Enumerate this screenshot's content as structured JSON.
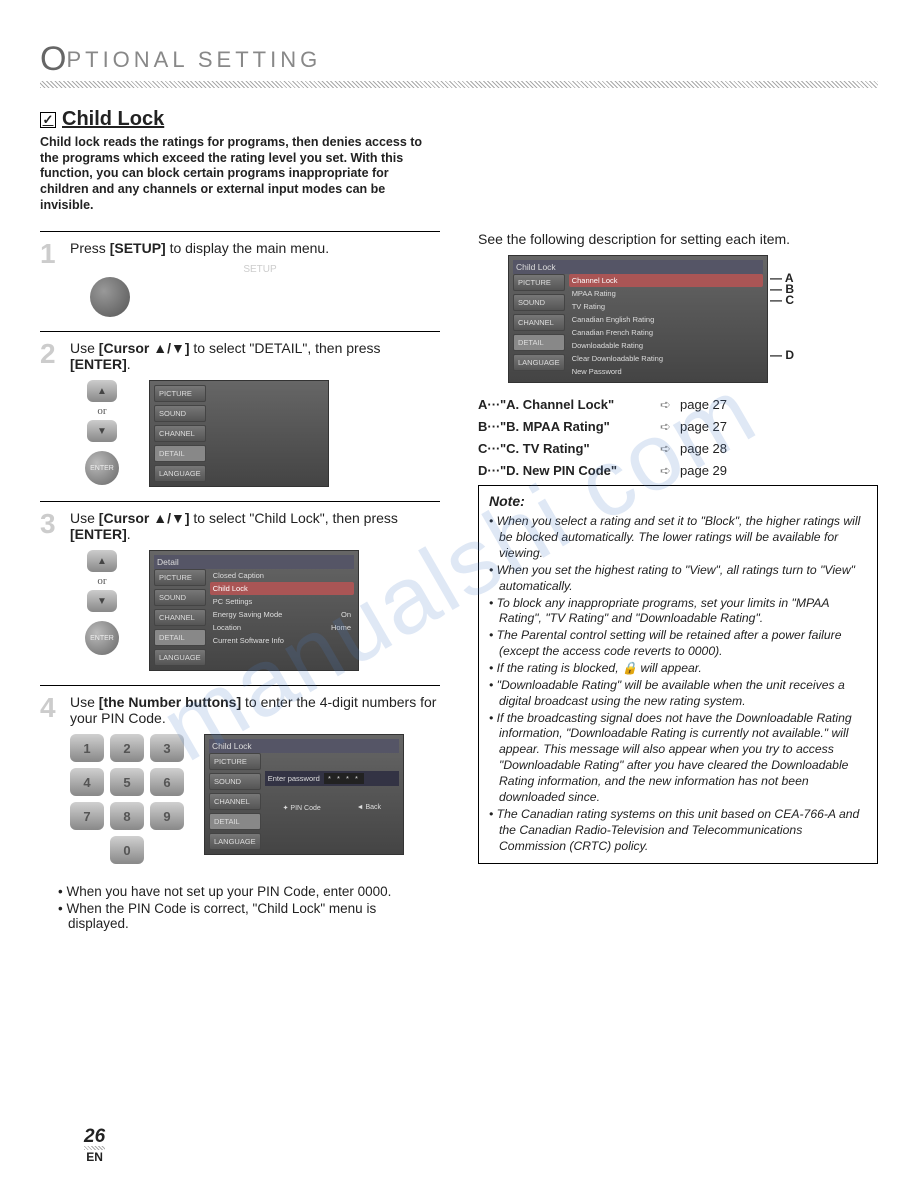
{
  "header": {
    "category": "PTIONAL   SETTING"
  },
  "section": {
    "title": "Child Lock",
    "intro": "Child lock reads the ratings for programs, then denies access to the programs which exceed the rating level you set. With this function, you can block certain programs inappropriate for children and any channels or external input modes can be invisible."
  },
  "steps": {
    "s1": {
      "num": "1",
      "text_a": "Press ",
      "btn": "[SETUP]",
      "text_b": " to display the main menu.",
      "label": "SETUP"
    },
    "s2": {
      "num": "2",
      "text_a": "Use ",
      "btn": "[Cursor ▲/▼]",
      "text_b": " to select \"DETAIL\", then press ",
      "btn2": "[ENTER]",
      "text_c": ".",
      "or": "or",
      "enter": "ENTER"
    },
    "s3": {
      "num": "3",
      "text_a": "Use ",
      "btn": "[Cursor ▲/▼]",
      "text_b": " to select \"Child Lock\", then press ",
      "btn2": "[ENTER]",
      "text_c": ".",
      "or": "or",
      "enter": "ENTER"
    },
    "s4": {
      "num": "4",
      "text_a": "Use ",
      "btn": "[the Number buttons]",
      "text_b": " to enter the 4-digit numbers for your PIN Code."
    },
    "bullets": [
      "When you have not set up your PIN Code, enter 0000.",
      "When the PIN Code is correct, \"Child Lock\" menu is displayed."
    ]
  },
  "keypad": [
    "1",
    "2",
    "3",
    "4",
    "5",
    "6",
    "7",
    "8",
    "9",
    "0"
  ],
  "osd_tabs": [
    "PICTURE",
    "SOUND",
    "CHANNEL",
    "DETAIL",
    "LANGUAGE"
  ],
  "osd2_items": [
    "",
    "",
    "",
    "",
    ""
  ],
  "osd3": {
    "title": "Detail",
    "items": [
      "Closed Caption",
      "Child Lock",
      "PC Settings",
      "Energy Saving Mode",
      "Location",
      "Current Software Info"
    ],
    "vals": [
      "",
      "",
      "",
      "On",
      "Home",
      ""
    ]
  },
  "osd4": {
    "title": "Child Lock",
    "enter_pw": "Enter password",
    "footer_l": "PIN Code",
    "footer_r": "Back"
  },
  "right": {
    "intro": "See the following description for setting each item.",
    "osd_title": "Child Lock",
    "osd_items": [
      "Channel Lock",
      "MPAA Rating",
      "TV Rating",
      "Canadian English Rating",
      "Canadian French Rating",
      "Downloadable Rating",
      "Clear Downloadable Rating",
      "New Password"
    ],
    "callouts": {
      "A": "A",
      "B": "B",
      "C": "C",
      "D": "D"
    },
    "legend": [
      {
        "k": "A",
        "t": "\"A. Channel Lock\"",
        "p": "page 27"
      },
      {
        "k": "B",
        "t": "\"B. MPAA Rating\"",
        "p": "page 27"
      },
      {
        "k": "C",
        "t": "\"C. TV Rating\"",
        "p": "page 28"
      },
      {
        "k": "D",
        "t": "\"D. New PIN Code\"",
        "p": "page 29"
      }
    ],
    "note_title": "Note:",
    "notes": [
      "When you select a rating and set it to \"Block\", the higher ratings will be blocked automatically. The lower ratings will be available for viewing.",
      "When you set the highest rating to \"View\", all ratings turn to \"View\" automatically.",
      "To block any inappropriate programs, set your limits in \"MPAA Rating\", \"TV Rating\" and \"Downloadable Rating\".",
      "The Parental control setting will be retained after a power failure (except the access code reverts to 0000).",
      "If the rating is blocked, 🔒 will appear.",
      "\"Downloadable Rating\" will be available when the unit receives a digital broadcast using the new rating system.",
      "If the broadcasting signal does not have the Downloadable Rating information, \"Downloadable Rating is currently not available.\" will appear. This message will also appear when you try to access \"Downloadable Rating\" after you have cleared the Downloadable Rating information, and the new information has not been downloaded since.",
      "The Canadian rating systems on this unit based on CEA-766-A and the Canadian Radio-Television and Telecommunications Commission (CRTC) policy."
    ]
  },
  "page": {
    "num": "26",
    "lang": "EN"
  },
  "watermark": "manualshi    com"
}
